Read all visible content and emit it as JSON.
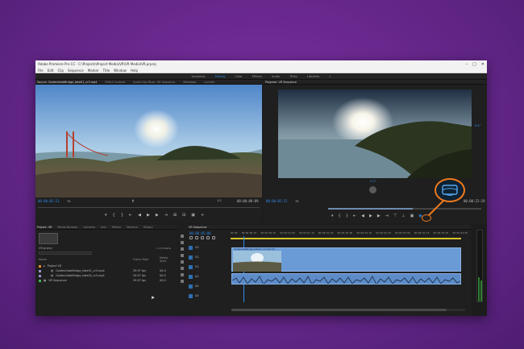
{
  "window": {
    "title": "Adobe Premiere Pro CC - C:\\Projects\\Project Media\\VR\\VR Media\\VR.prproj",
    "controls": [
      "–",
      "□",
      "✕"
    ]
  },
  "menu": [
    "File",
    "Edit",
    "Clip",
    "Sequence",
    "Marker",
    "Title",
    "Window",
    "Help"
  ],
  "workspaces": [
    "Assembly",
    "Editing",
    "Color",
    "Effects",
    "Audio",
    "Titles",
    "Libraries",
    "»"
  ],
  "source": {
    "tabs": [
      "Source: GoldenGateBridge_take01_vr3.mp4",
      "Effect Controls",
      "Audio Clip Mixer: VR Sequence",
      "Metadata",
      "Lumetri"
    ],
    "tc_left": "00:00:02:21",
    "fit": "Fit",
    "quality": "1/2",
    "tc_right": "00:00:09:09"
  },
  "program": {
    "tabs": [
      "Program: VR Sequence"
    ],
    "tc_left": "00:00:05:12",
    "fit": "Fit",
    "quality": "1/2",
    "tc_right": "00:00:22:19",
    "angle_h": "6.4°",
    "angle_v": "0.0°"
  },
  "project": {
    "tabs": [
      "Project: VR",
      "Media Browser",
      "Libraries",
      "Info",
      "Effects",
      "Markers",
      "History"
    ],
    "search_label": "VR.prproj",
    "count": "1 of 4 Items",
    "col_name": "Name",
    "col_fps": "Frame Rate",
    "col_start": "Media Start",
    "items": [
      {
        "name": "Project VR",
        "fps": "",
        "start": ""
      },
      {
        "name": "GoldenGateBridge_take01_vr3.mp4",
        "fps": "29.97 fps",
        "start": "00:0"
      },
      {
        "name": "GoldenGateBridge_take02_vr3.mp4",
        "fps": "29.97 fps",
        "start": "00:0"
      },
      {
        "name": "VR Sequence",
        "fps": "29.97 fps",
        "start": "00:0"
      }
    ]
  },
  "timeline": {
    "tab": "VR Sequence",
    "tc": "00:00:05:00",
    "ruler": [
      "00:00",
      "00:00:00:10",
      "00:00:00:20",
      "00:00:01:00",
      "00:00:01:10",
      "00:00:01:20",
      "00:00:02:00",
      "00:00:02:10",
      "00:00:02:20",
      "00:00:03:00",
      "00:00:03:10",
      "00:00:03:20",
      "00:00:04:00"
    ],
    "tracks": [
      "V3",
      "V2",
      "V1",
      "A1",
      "A2",
      "A3"
    ],
    "clip_label": "GoldenGateBridge_take01_vr3.mp4 [V]"
  },
  "colors": {
    "accent": "#2d8ceb",
    "callout": "#f07a1c",
    "bg": "#6a2a8c"
  },
  "icons": [
    "vr-video-display-icon",
    "marker-icon",
    "play-icon",
    "step-back-icon",
    "step-forward-icon",
    "insert-icon",
    "overwrite-icon",
    "export-frame-icon",
    "settings-wrench-icon"
  ]
}
